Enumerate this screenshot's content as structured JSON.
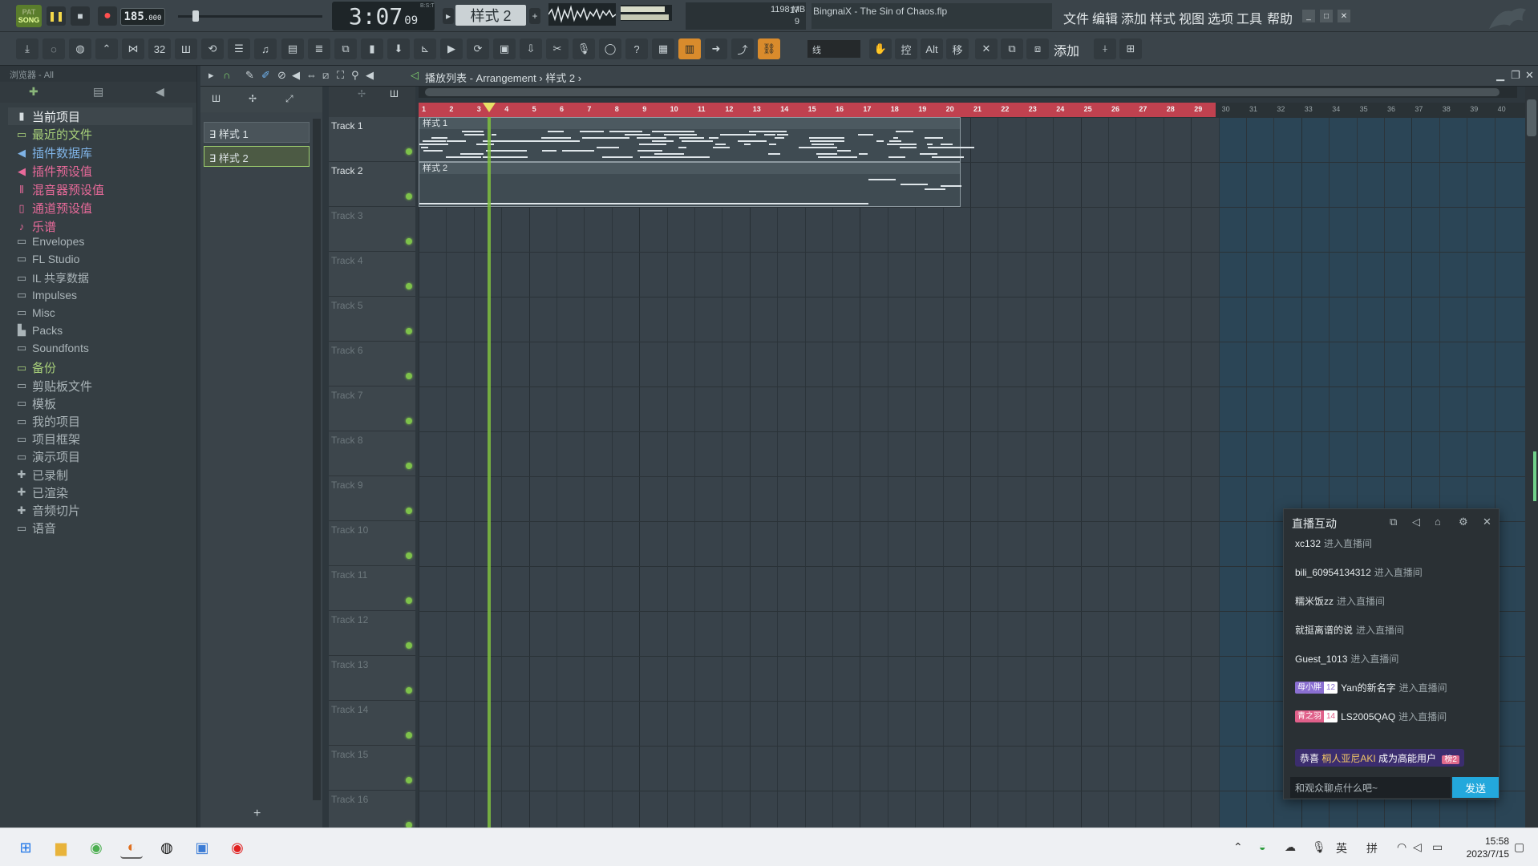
{
  "topbar": {
    "song_mode": "SONG",
    "pat_mode": "PAT",
    "tempo": "185",
    "tempo_decimal": ".000",
    "time_main": "3:07",
    "time_sub": "09",
    "time_caption": "B:S:T",
    "pattern_selector": "样式 2",
    "cpu_value": "17",
    "memory": "1198 MB",
    "polyphony": "9",
    "hint_text": "BingnaiX - The Sin of Chaos.flp",
    "menus": [
      "文件",
      "编辑",
      "添加",
      "样式",
      "视图",
      "选项",
      "工具",
      "帮助"
    ],
    "snap_label": "线",
    "add_label": "添加"
  },
  "browser": {
    "header": "浏览器 - All",
    "items": [
      {
        "label": "当前项目",
        "icon": "document-icon",
        "color": "#d6dde0"
      },
      {
        "label": "最近的文件",
        "icon": "folder-icon",
        "color": "#a8d07a"
      },
      {
        "label": "插件数据库",
        "icon": "plugin-icon",
        "color": "#7fb3e6"
      },
      {
        "label": "插件预设值",
        "icon": "plugin-icon",
        "color": "#e86a9a"
      },
      {
        "label": "混音器预设值",
        "icon": "mixer-icon",
        "color": "#e86a9a"
      },
      {
        "label": "通道预设值",
        "icon": "channel-icon",
        "color": "#e86a9a"
      },
      {
        "label": "乐谱",
        "icon": "note-icon",
        "color": "#e86a9a"
      },
      {
        "label": "Envelopes",
        "icon": "folder-icon",
        "color": "#aab4b8"
      },
      {
        "label": "FL Studio",
        "icon": "folder-icon",
        "color": "#aab4b8"
      },
      {
        "label": "IL 共享数据",
        "icon": "folder-icon",
        "color": "#aab4b8"
      },
      {
        "label": "Impulses",
        "icon": "folder-icon",
        "color": "#aab4b8"
      },
      {
        "label": "Misc",
        "icon": "folder-icon",
        "color": "#aab4b8"
      },
      {
        "label": "Packs",
        "icon": "packs-icon",
        "color": "#aab4b8"
      },
      {
        "label": "Soundfonts",
        "icon": "folder-icon",
        "color": "#aab4b8"
      },
      {
        "label": "备份",
        "icon": "folder-icon",
        "color": "#a8d07a"
      },
      {
        "label": "剪贴板文件",
        "icon": "folder-icon",
        "color": "#aab4b8"
      },
      {
        "label": "模板",
        "icon": "folder-icon",
        "color": "#aab4b8"
      },
      {
        "label": "我的项目",
        "icon": "folder-icon",
        "color": "#aab4b8"
      },
      {
        "label": "项目框架",
        "icon": "folder-icon",
        "color": "#aab4b8"
      },
      {
        "label": "演示项目",
        "icon": "folder-icon",
        "color": "#aab4b8"
      },
      {
        "label": "已录制",
        "icon": "recorded-icon",
        "color": "#aab4b8"
      },
      {
        "label": "已渲染",
        "icon": "rendered-icon",
        "color": "#aab4b8"
      },
      {
        "label": "音频切片",
        "icon": "slice-icon",
        "color": "#aab4b8"
      },
      {
        "label": "语音",
        "icon": "folder-icon",
        "color": "#aab4b8"
      }
    ]
  },
  "playlist": {
    "breadcrumb": "播放列表 - Arrangement",
    "breadcrumb_pattern": "样式 2",
    "patterns": [
      "样式 1",
      "样式 2"
    ],
    "tracks": [
      "Track 1",
      "Track 2",
      "Track 3",
      "Track 4",
      "Track 5",
      "Track 6",
      "Track 7",
      "Track 8",
      "Track 9",
      "Track 10",
      "Track 11",
      "Track 12",
      "Track 13",
      "Track 14",
      "Track 15",
      "Track 16"
    ],
    "clip1_label": "样式 1",
    "clip2_label": "样式 2",
    "bars": [
      "1",
      "2",
      "3",
      "4",
      "5",
      "6",
      "7",
      "8",
      "9",
      "10",
      "11",
      "12",
      "13",
      "14",
      "15",
      "16",
      "17",
      "18",
      "19",
      "20",
      "21",
      "22",
      "23",
      "24",
      "25",
      "26",
      "27",
      "28",
      "29",
      "30",
      "31",
      "32",
      "33",
      "34",
      "35",
      "36",
      "37",
      "38",
      "39",
      "40"
    ],
    "loop_end_bar": 29,
    "playhead_bar": 3.5
  },
  "live": {
    "title": "直播互动",
    "messages": [
      {
        "user": "xc132",
        "action": "进入直播间"
      },
      {
        "user": "bili_60954134312",
        "action": "进入直播间"
      },
      {
        "user": "糯米饭zz",
        "action": "进入直播间"
      },
      {
        "user": "就挺离谱的说",
        "action": "进入直播间"
      },
      {
        "user": "Guest_1013",
        "action": "进入直播间"
      },
      {
        "user": "Yan的新名字",
        "action": "进入直播间",
        "badge": "母小胖",
        "level": "12",
        "badge_color": "#8a6fd1"
      },
      {
        "user": "LS2005QAQ",
        "action": "进入直播间",
        "badge": "青之羽",
        "level": "14",
        "badge_color": "#e0608a"
      }
    ],
    "congrats_prefix": "恭喜",
    "congrats_user": "桐人亚尼AKI",
    "congrats_suffix": "成为高能用户",
    "congrats_tag": "榜2",
    "input_placeholder": "和观众聊点什么吧~",
    "send_label": "发送"
  },
  "taskbar": {
    "ime_lang": "英",
    "ime_mode": "拼",
    "time": "15:58",
    "date": "2023/7/15"
  }
}
